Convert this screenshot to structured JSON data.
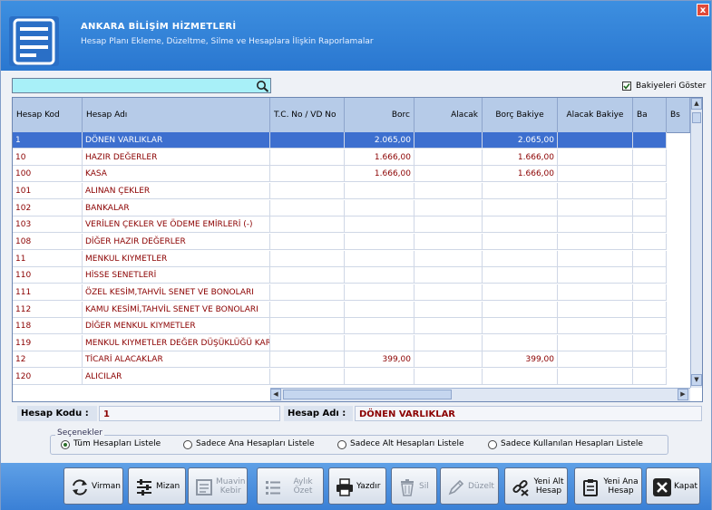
{
  "header": {
    "title": "ANKARA BİLİŞİM HİZMETLERİ",
    "subtitle": "Hesap Planı Ekleme, Düzeltme, Silme ve Hesaplara İlişkin Raporlamalar",
    "close_label": "x"
  },
  "search": {
    "value": "",
    "placeholder": ""
  },
  "bakiye_checkbox": {
    "label": "Bakiyeleri Göster",
    "checked": true
  },
  "grid": {
    "columns": [
      "Hesap Kod",
      "Hesap Adı",
      "T.C. No / VD No",
      "Borc",
      "Alacak",
      "Borç Bakiye",
      "Alacak Bakiye",
      "Ba",
      "Bs"
    ],
    "rows": [
      {
        "kod": "1",
        "ad": "DÖNEN VARLIKLAR",
        "borc": "2.065,00",
        "borc_bakiye": "2.065,00",
        "selected": true
      },
      {
        "kod": "10",
        "ad": "HAZIR DEĞERLER",
        "borc": "1.666,00",
        "borc_bakiye": "1.666,00"
      },
      {
        "kod": "100",
        "ad": "KASA",
        "borc": "1.666,00",
        "borc_bakiye": "1.666,00"
      },
      {
        "kod": "101",
        "ad": "ALINAN ÇEKLER",
        "borc": "",
        "borc_bakiye": ""
      },
      {
        "kod": "102",
        "ad": "BANKALAR",
        "borc": "",
        "borc_bakiye": ""
      },
      {
        "kod": "103",
        "ad": "VERİLEN ÇEKLER VE ÖDEME EMİRLERİ (-)",
        "borc": "",
        "borc_bakiye": ""
      },
      {
        "kod": "108",
        "ad": "DİĞER HAZIR DEĞERLER",
        "borc": "",
        "borc_bakiye": ""
      },
      {
        "kod": "11",
        "ad": "MENKUL KIYMETLER",
        "borc": "",
        "borc_bakiye": ""
      },
      {
        "kod": "110",
        "ad": "HİSSE SENETLERİ",
        "borc": "",
        "borc_bakiye": ""
      },
      {
        "kod": "111",
        "ad": "ÖZEL KESİM,TAHVİL SENET VE BONOLARI",
        "borc": "",
        "borc_bakiye": ""
      },
      {
        "kod": "112",
        "ad": "KAMU KESİMİ,TAHVİL SENET VE BONOLARI",
        "borc": "",
        "borc_bakiye": ""
      },
      {
        "kod": "118",
        "ad": "DİĞER MENKUL KIYMETLER",
        "borc": "",
        "borc_bakiye": ""
      },
      {
        "kod": "119",
        "ad": "MENKUL KIYMETLER DEĞER DÜŞÜKLÜĞÜ KAR...",
        "borc": "",
        "borc_bakiye": ""
      },
      {
        "kod": "12",
        "ad": "TİCARİ ALACAKLAR",
        "borc": "399,00",
        "borc_bakiye": "399,00"
      },
      {
        "kod": "120",
        "ad": "ALICILAR",
        "borc": "",
        "borc_bakiye": ""
      }
    ]
  },
  "info": {
    "kod_label": "Hesap Kodu :",
    "kod_value": "1",
    "ad_label": "Hesap Adı :",
    "ad_value": "DÖNEN VARLIKLAR"
  },
  "options": {
    "legend": "Seçenekler",
    "items": [
      "Tüm Hesapları Listele",
      "Sadece Ana Hesapları Listele",
      "Sadece Alt Hesapları Listele",
      "Sadece Kullanılan Hesapları Listele"
    ],
    "selected_index": 0
  },
  "toolbar": {
    "buttons": [
      {
        "label": "Virman",
        "icon": "transfer-arrows-icon",
        "enabled": true
      },
      {
        "label": "Mizan",
        "icon": "sliders-icon",
        "enabled": true
      },
      {
        "label": "Muavin Kebir",
        "icon": "ledger-icon",
        "enabled": false
      },
      {
        "label": "Aylık Özet",
        "icon": "list-icon",
        "enabled": false
      },
      {
        "label": "Yazdır",
        "icon": "printer-icon",
        "enabled": true
      },
      {
        "label": "Sil",
        "icon": "trash-icon",
        "enabled": false
      },
      {
        "label": "Düzelt",
        "icon": "pencil-icon",
        "enabled": false
      },
      {
        "label": "Yeni Alt Hesap",
        "icon": "link-icon",
        "enabled": true
      },
      {
        "label": "Yeni Ana Hesap",
        "icon": "clipboard-icon",
        "enabled": true
      },
      {
        "label": "Kapat",
        "icon": "close-icon",
        "enabled": true
      }
    ]
  },
  "colors": {
    "header_blue": "#2a77d0",
    "selected_row": "#3d6fcf",
    "text_red": "#8b0000",
    "search_bg": "#a8f0f8"
  }
}
